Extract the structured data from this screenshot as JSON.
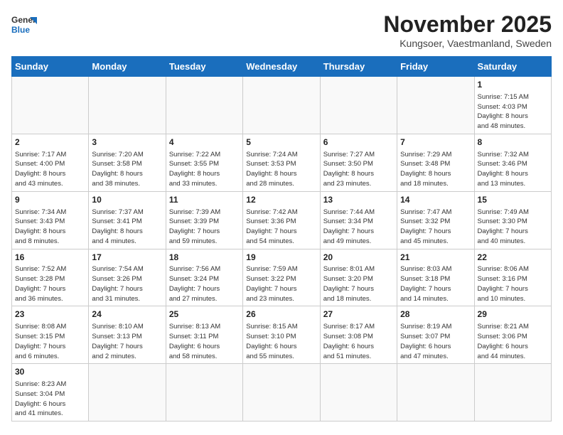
{
  "logo": {
    "text_general": "General",
    "text_blue": "Blue"
  },
  "title": "November 2025",
  "subtitle": "Kungsoer, Vaestmanland, Sweden",
  "weekdays": [
    "Sunday",
    "Monday",
    "Tuesday",
    "Wednesday",
    "Thursday",
    "Friday",
    "Saturday"
  ],
  "weeks": [
    [
      {
        "day": "",
        "info": ""
      },
      {
        "day": "",
        "info": ""
      },
      {
        "day": "",
        "info": ""
      },
      {
        "day": "",
        "info": ""
      },
      {
        "day": "",
        "info": ""
      },
      {
        "day": "",
        "info": ""
      },
      {
        "day": "1",
        "info": "Sunrise: 7:15 AM\nSunset: 4:03 PM\nDaylight: 8 hours\nand 48 minutes."
      }
    ],
    [
      {
        "day": "2",
        "info": "Sunrise: 7:17 AM\nSunset: 4:00 PM\nDaylight: 8 hours\nand 43 minutes."
      },
      {
        "day": "3",
        "info": "Sunrise: 7:20 AM\nSunset: 3:58 PM\nDaylight: 8 hours\nand 38 minutes."
      },
      {
        "day": "4",
        "info": "Sunrise: 7:22 AM\nSunset: 3:55 PM\nDaylight: 8 hours\nand 33 minutes."
      },
      {
        "day": "5",
        "info": "Sunrise: 7:24 AM\nSunset: 3:53 PM\nDaylight: 8 hours\nand 28 minutes."
      },
      {
        "day": "6",
        "info": "Sunrise: 7:27 AM\nSunset: 3:50 PM\nDaylight: 8 hours\nand 23 minutes."
      },
      {
        "day": "7",
        "info": "Sunrise: 7:29 AM\nSunset: 3:48 PM\nDaylight: 8 hours\nand 18 minutes."
      },
      {
        "day": "8",
        "info": "Sunrise: 7:32 AM\nSunset: 3:46 PM\nDaylight: 8 hours\nand 13 minutes."
      }
    ],
    [
      {
        "day": "9",
        "info": "Sunrise: 7:34 AM\nSunset: 3:43 PM\nDaylight: 8 hours\nand 8 minutes."
      },
      {
        "day": "10",
        "info": "Sunrise: 7:37 AM\nSunset: 3:41 PM\nDaylight: 8 hours\nand 4 minutes."
      },
      {
        "day": "11",
        "info": "Sunrise: 7:39 AM\nSunset: 3:39 PM\nDaylight: 7 hours\nand 59 minutes."
      },
      {
        "day": "12",
        "info": "Sunrise: 7:42 AM\nSunset: 3:36 PM\nDaylight: 7 hours\nand 54 minutes."
      },
      {
        "day": "13",
        "info": "Sunrise: 7:44 AM\nSunset: 3:34 PM\nDaylight: 7 hours\nand 49 minutes."
      },
      {
        "day": "14",
        "info": "Sunrise: 7:47 AM\nSunset: 3:32 PM\nDaylight: 7 hours\nand 45 minutes."
      },
      {
        "day": "15",
        "info": "Sunrise: 7:49 AM\nSunset: 3:30 PM\nDaylight: 7 hours\nand 40 minutes."
      }
    ],
    [
      {
        "day": "16",
        "info": "Sunrise: 7:52 AM\nSunset: 3:28 PM\nDaylight: 7 hours\nand 36 minutes."
      },
      {
        "day": "17",
        "info": "Sunrise: 7:54 AM\nSunset: 3:26 PM\nDaylight: 7 hours\nand 31 minutes."
      },
      {
        "day": "18",
        "info": "Sunrise: 7:56 AM\nSunset: 3:24 PM\nDaylight: 7 hours\nand 27 minutes."
      },
      {
        "day": "19",
        "info": "Sunrise: 7:59 AM\nSunset: 3:22 PM\nDaylight: 7 hours\nand 23 minutes."
      },
      {
        "day": "20",
        "info": "Sunrise: 8:01 AM\nSunset: 3:20 PM\nDaylight: 7 hours\nand 18 minutes."
      },
      {
        "day": "21",
        "info": "Sunrise: 8:03 AM\nSunset: 3:18 PM\nDaylight: 7 hours\nand 14 minutes."
      },
      {
        "day": "22",
        "info": "Sunrise: 8:06 AM\nSunset: 3:16 PM\nDaylight: 7 hours\nand 10 minutes."
      }
    ],
    [
      {
        "day": "23",
        "info": "Sunrise: 8:08 AM\nSunset: 3:15 PM\nDaylight: 7 hours\nand 6 minutes."
      },
      {
        "day": "24",
        "info": "Sunrise: 8:10 AM\nSunset: 3:13 PM\nDaylight: 7 hours\nand 2 minutes."
      },
      {
        "day": "25",
        "info": "Sunrise: 8:13 AM\nSunset: 3:11 PM\nDaylight: 6 hours\nand 58 minutes."
      },
      {
        "day": "26",
        "info": "Sunrise: 8:15 AM\nSunset: 3:10 PM\nDaylight: 6 hours\nand 55 minutes."
      },
      {
        "day": "27",
        "info": "Sunrise: 8:17 AM\nSunset: 3:08 PM\nDaylight: 6 hours\nand 51 minutes."
      },
      {
        "day": "28",
        "info": "Sunrise: 8:19 AM\nSunset: 3:07 PM\nDaylight: 6 hours\nand 47 minutes."
      },
      {
        "day": "29",
        "info": "Sunrise: 8:21 AM\nSunset: 3:06 PM\nDaylight: 6 hours\nand 44 minutes."
      }
    ],
    [
      {
        "day": "30",
        "info": "Sunrise: 8:23 AM\nSunset: 3:04 PM\nDaylight: 6 hours\nand 41 minutes."
      },
      {
        "day": "",
        "info": ""
      },
      {
        "day": "",
        "info": ""
      },
      {
        "day": "",
        "info": ""
      },
      {
        "day": "",
        "info": ""
      },
      {
        "day": "",
        "info": ""
      },
      {
        "day": "",
        "info": ""
      }
    ]
  ]
}
